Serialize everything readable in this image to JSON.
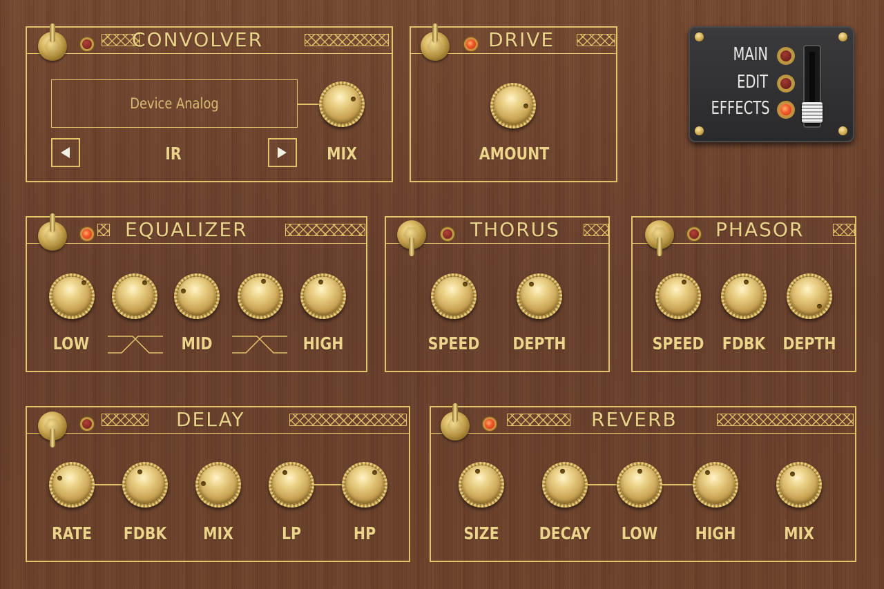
{
  "convolver": {
    "title": "CONVOLVER",
    "enabled": true,
    "display": "Device Analog",
    "ir_label": "IR",
    "mix_label": "MIX"
  },
  "drive": {
    "title": "DRIVE",
    "enabled": true,
    "amount_label": "AMOUNT"
  },
  "equalizer": {
    "title": "EQUALIZER",
    "enabled": true,
    "labels": [
      "LOW",
      "MID",
      "HIGH"
    ]
  },
  "thorus": {
    "title": "THORUS",
    "enabled": false,
    "labels": [
      "SPEED",
      "DEPTH"
    ]
  },
  "phasor": {
    "title": "PHASOR",
    "enabled": false,
    "labels": [
      "SPEED",
      "FDBK",
      "DEPTH"
    ]
  },
  "delay": {
    "title": "DELAY",
    "enabled": false,
    "labels": [
      "RATE",
      "FDBK",
      "MIX",
      "LP",
      "HP"
    ]
  },
  "reverb": {
    "title": "REVERB",
    "enabled": true,
    "labels": [
      "SIZE",
      "DECAY",
      "LOW",
      "HIGH",
      "MIX"
    ]
  },
  "nav": {
    "items": [
      "MAIN",
      "EDIT",
      "EFFECTS"
    ],
    "selected": "EFFECTS"
  },
  "colors": {
    "gold": "#e3c46d",
    "label": "#ecd48b",
    "led_on": "#f35a2a",
    "wood": "#6e4530",
    "nav_bg": "#2f2f31"
  }
}
